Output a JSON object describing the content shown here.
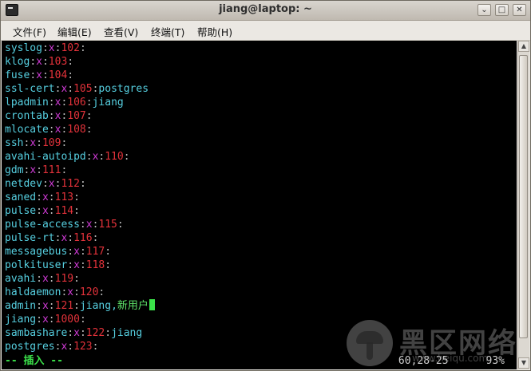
{
  "window": {
    "title": "jiang@laptop: ~",
    "minimize_glyph": "⌄",
    "maximize_glyph": "□",
    "close_glyph": "✕"
  },
  "menu": [
    {
      "label": "文件(F)"
    },
    {
      "label": "编辑(E)"
    },
    {
      "label": "查看(V)"
    },
    {
      "label": "终端(T)"
    },
    {
      "label": "帮助(H)"
    }
  ],
  "terminal": {
    "lines": [
      {
        "name": "syslog",
        "x": "x",
        "id": "102",
        "members": ""
      },
      {
        "name": "klog",
        "x": "x",
        "id": "103",
        "members": ""
      },
      {
        "name": "fuse",
        "x": "x",
        "id": "104",
        "members": ""
      },
      {
        "name": "ssl-cert",
        "x": "x",
        "id": "105",
        "members": "postgres"
      },
      {
        "name": "lpadmin",
        "x": "x",
        "id": "106",
        "members": "jiang"
      },
      {
        "name": "crontab",
        "x": "x",
        "id": "107",
        "members": ""
      },
      {
        "name": "mlocate",
        "x": "x",
        "id": "108",
        "members": ""
      },
      {
        "name": "ssh",
        "x": "x",
        "id": "109",
        "members": ""
      },
      {
        "name": "avahi-autoipd",
        "x": "x",
        "id": "110",
        "members": ""
      },
      {
        "name": "gdm",
        "x": "x",
        "id": "111",
        "members": ""
      },
      {
        "name": "netdev",
        "x": "x",
        "id": "112",
        "members": ""
      },
      {
        "name": "saned",
        "x": "x",
        "id": "113",
        "members": ""
      },
      {
        "name": "pulse",
        "x": "x",
        "id": "114",
        "members": ""
      },
      {
        "name": "pulse-access",
        "x": "x",
        "id": "115",
        "members": ""
      },
      {
        "name": "pulse-rt",
        "x": "x",
        "id": "116",
        "members": ""
      },
      {
        "name": "messagebus",
        "x": "x",
        "id": "117",
        "members": ""
      },
      {
        "name": "polkituser",
        "x": "x",
        "id": "118",
        "members": ""
      },
      {
        "name": "avahi",
        "x": "x",
        "id": "119",
        "members": ""
      },
      {
        "name": "haldaemon",
        "x": "x",
        "id": "120",
        "members": ""
      },
      {
        "name": "admin",
        "x": "x",
        "id": "121",
        "members": "jiang,",
        "typed": "新用户",
        "cursor": true
      },
      {
        "name": "jiang",
        "x": "x",
        "id": "1000",
        "members": ""
      },
      {
        "name": "sambashare",
        "x": "x",
        "id": "122",
        "members": "jiang"
      },
      {
        "name": "postgres",
        "x": "x",
        "id": "123",
        "members": ""
      }
    ],
    "status_mode": "-- 插入 --",
    "status_position": "60,28-25",
    "status_percent": "93%"
  },
  "watermark": {
    "text": "黑区网络",
    "url": "www.heiqu.com"
  },
  "colors": {
    "name": "#56cfe0",
    "x": "#d03bd6",
    "id": "#e3323a",
    "typed": "#5ee36a",
    "mode": "#3be24a"
  }
}
